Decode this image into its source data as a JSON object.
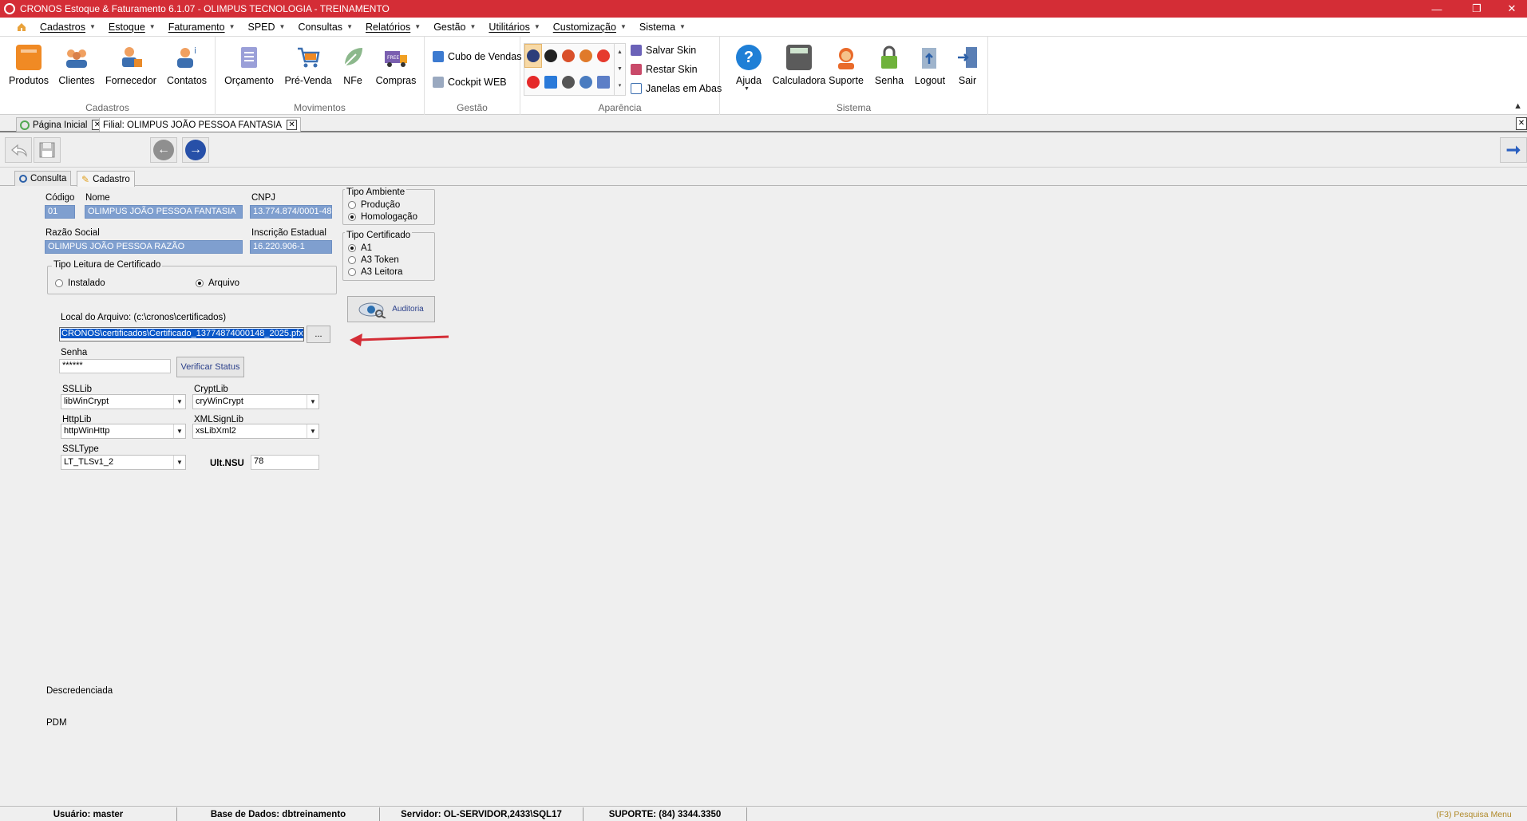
{
  "window": {
    "title": "CRONOS Estoque & Faturamento 6.1.07 - OLIMPUS TECNOLOGIA - TREINAMENTO"
  },
  "menu": [
    "Cadastros",
    "Estoque",
    "Faturamento",
    "SPED",
    "Consultas",
    "Relatórios",
    "Gestão",
    "Utilitários",
    "Customização",
    "Sistema"
  ],
  "ribbon": {
    "cadastros": {
      "title": "Cadastros",
      "buttons": [
        "Produtos",
        "Clientes",
        "Fornecedor",
        "Contatos"
      ]
    },
    "movimentos": {
      "title": "Movimentos",
      "buttons": [
        "Orçamento",
        "Pré-Venda",
        "NFe",
        "Compras"
      ]
    },
    "gestao": {
      "title": "Gestão",
      "buttons": [
        "Cubo de Vendas",
        "Cockpit WEB"
      ]
    },
    "aparencia": {
      "title": "Aparência",
      "buttons": [
        "Salvar Skin",
        "Restar Skin",
        "Janelas em Abas"
      ]
    },
    "sistema": {
      "title": "Sistema",
      "buttons": [
        "Ajuda",
        "Calculadora",
        "Suporte",
        "Senha",
        "Logout",
        "Sair"
      ]
    }
  },
  "doc_tabs": [
    "Página Inicial",
    "Filial: OLIMPUS JOÃO PESSOA FANTASIA"
  ],
  "form_tabs": [
    "Consulta",
    "Cadastro"
  ],
  "form": {
    "codigo_label": "Código",
    "codigo": "01",
    "nome_label": "Nome",
    "nome": "OLIMPUS JOÃO PESSOA FANTASIA",
    "cnpj_label": "CNPJ",
    "cnpj": "13.774.874/0001-48",
    "razao_label": "Razão Social",
    "razao": "OLIMPUS JOÃO PESSOA RAZÃO",
    "ie_label": "Inscrição Estadual",
    "ie": "16.220.906-1",
    "leitura_title": "Tipo Leitura de Certificado",
    "leitura_opts": [
      "Instalado",
      "Arquivo"
    ],
    "leitura_selected": "Arquivo",
    "ambiente_title": "Tipo Ambiente",
    "ambiente_opts": [
      "Produção",
      "Homologação"
    ],
    "ambiente_selected": "Homologação",
    "certificado_title": "Tipo Certificado",
    "certificado_opts": [
      "A1",
      "A3 Token",
      "A3 Leitora"
    ],
    "certificado_selected": "A1",
    "auditoria": "Auditoria",
    "local_label": "Local do Arquivo: (c:\\cronos\\certificados)",
    "local_value": "CRONOS\\certificados\\Certificado_13774874000148_2025.pfx",
    "browse": "...",
    "senha_label": "Senha",
    "senha": "******",
    "verificar": "Verificar Status",
    "ssllib_label": "SSLLib",
    "ssllib": "libWinCrypt",
    "cryptlib_label": "CryptLib",
    "cryptlib": "cryWinCrypt",
    "httplib_label": "HttpLib",
    "httplib": "httpWinHttp",
    "xmlsignlib_label": "XMLSignLib",
    "xmlsignlib": "xsLibXml2",
    "ssltype_label": "SSLType",
    "ssltype": "LT_TLSv1_2",
    "ultnsu_label": "Ult.NSU",
    "ultnsu": "78",
    "descredenciada": "Descredenciada",
    "pdm": "PDM"
  },
  "status": {
    "usuario": "Usuário: master",
    "base": "Base de Dados: dbtreinamento",
    "servidor": "Servidor: OL-SERVIDOR,2433\\SQL17",
    "suporte": "SUPORTE: (84) 3344.3350",
    "pesquisa": "(F3) Pesquisa Menu"
  },
  "colors": {
    "titlebar": "#d42d36",
    "selection": "#7f9fcf",
    "arrow": "#d42d36"
  }
}
